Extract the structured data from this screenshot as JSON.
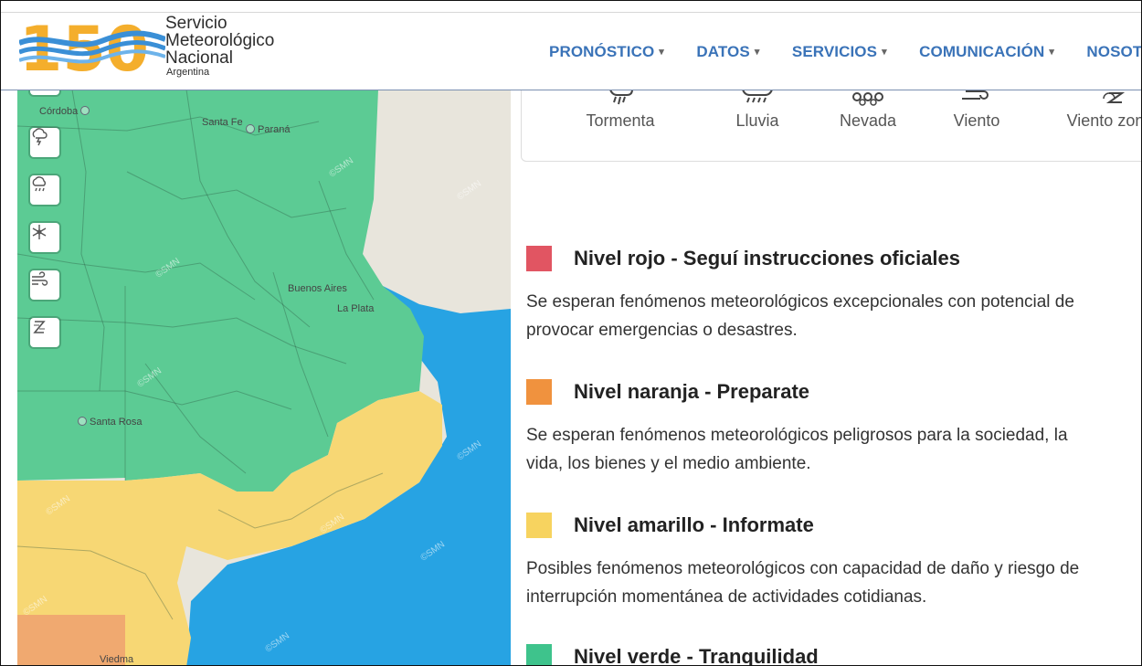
{
  "brand": {
    "logo_text": "150",
    "line1": "Servicio",
    "line2": "Meteorológico",
    "line3": "Nacional",
    "line4": "Argentina"
  },
  "nav": [
    {
      "label": "PRONÓSTICO",
      "caret": "▾"
    },
    {
      "label": "DATOS",
      "caret": "▾"
    },
    {
      "label": "SERVICIOS",
      "caret": "▾"
    },
    {
      "label": "COMUNICACIÓN",
      "caret": "▾"
    },
    {
      "label": "NOSOTROS",
      "caret": ""
    }
  ],
  "map": {
    "layer_buttons": [
      "storm-icon",
      "rain-icon",
      "snow-icon",
      "wind-icon",
      "zonda-icon"
    ],
    "cities": [
      "Córdoba",
      "Santa Fe",
      "Paraná",
      "Buenos Aires",
      "La Plata",
      "Santa Rosa",
      "Viedma"
    ],
    "watermark": "©SMN",
    "colors": {
      "green": "#5ccb94",
      "yellow": "#f7d774",
      "orange": "#f0a970",
      "sea": "#27a3e3",
      "land": "#e8e5dc"
    }
  },
  "phenomena": [
    {
      "label": "Tormenta",
      "icon": "storm-icon"
    },
    {
      "label": "Lluvia",
      "icon": "rain-icon"
    },
    {
      "label": "Nevada",
      "icon": "snow-icon"
    },
    {
      "label": "Viento",
      "icon": "wind-icon"
    },
    {
      "label": "Viento zonda",
      "icon": "zonda-icon"
    }
  ],
  "levels": [
    {
      "title": "Nivel rojo - Seguí instrucciones oficiales",
      "color": "#e15562",
      "line1": "Se esperan fenómenos meteorológicos excepcionales con potencial de",
      "line2": "provocar emergencias o desastres."
    },
    {
      "title": "Nivel naranja - Preparate",
      "color": "#f0923e",
      "line1": "Se esperan fenómenos meteorológicos peligrosos para la sociedad, la",
      "line2": "vida, los bienes y el medio ambiente."
    },
    {
      "title": "Nivel amarillo - Informate",
      "color": "#f7d35f",
      "line1": "Posibles fenómenos meteorológicos con capacidad de daño y riesgo de",
      "line2": "interrupción momentánea de actividades cotidianas."
    },
    {
      "title": "Nivel verde - Tranquilidad",
      "color": "#3ec38c",
      "line1": "",
      "line2": ""
    }
  ]
}
